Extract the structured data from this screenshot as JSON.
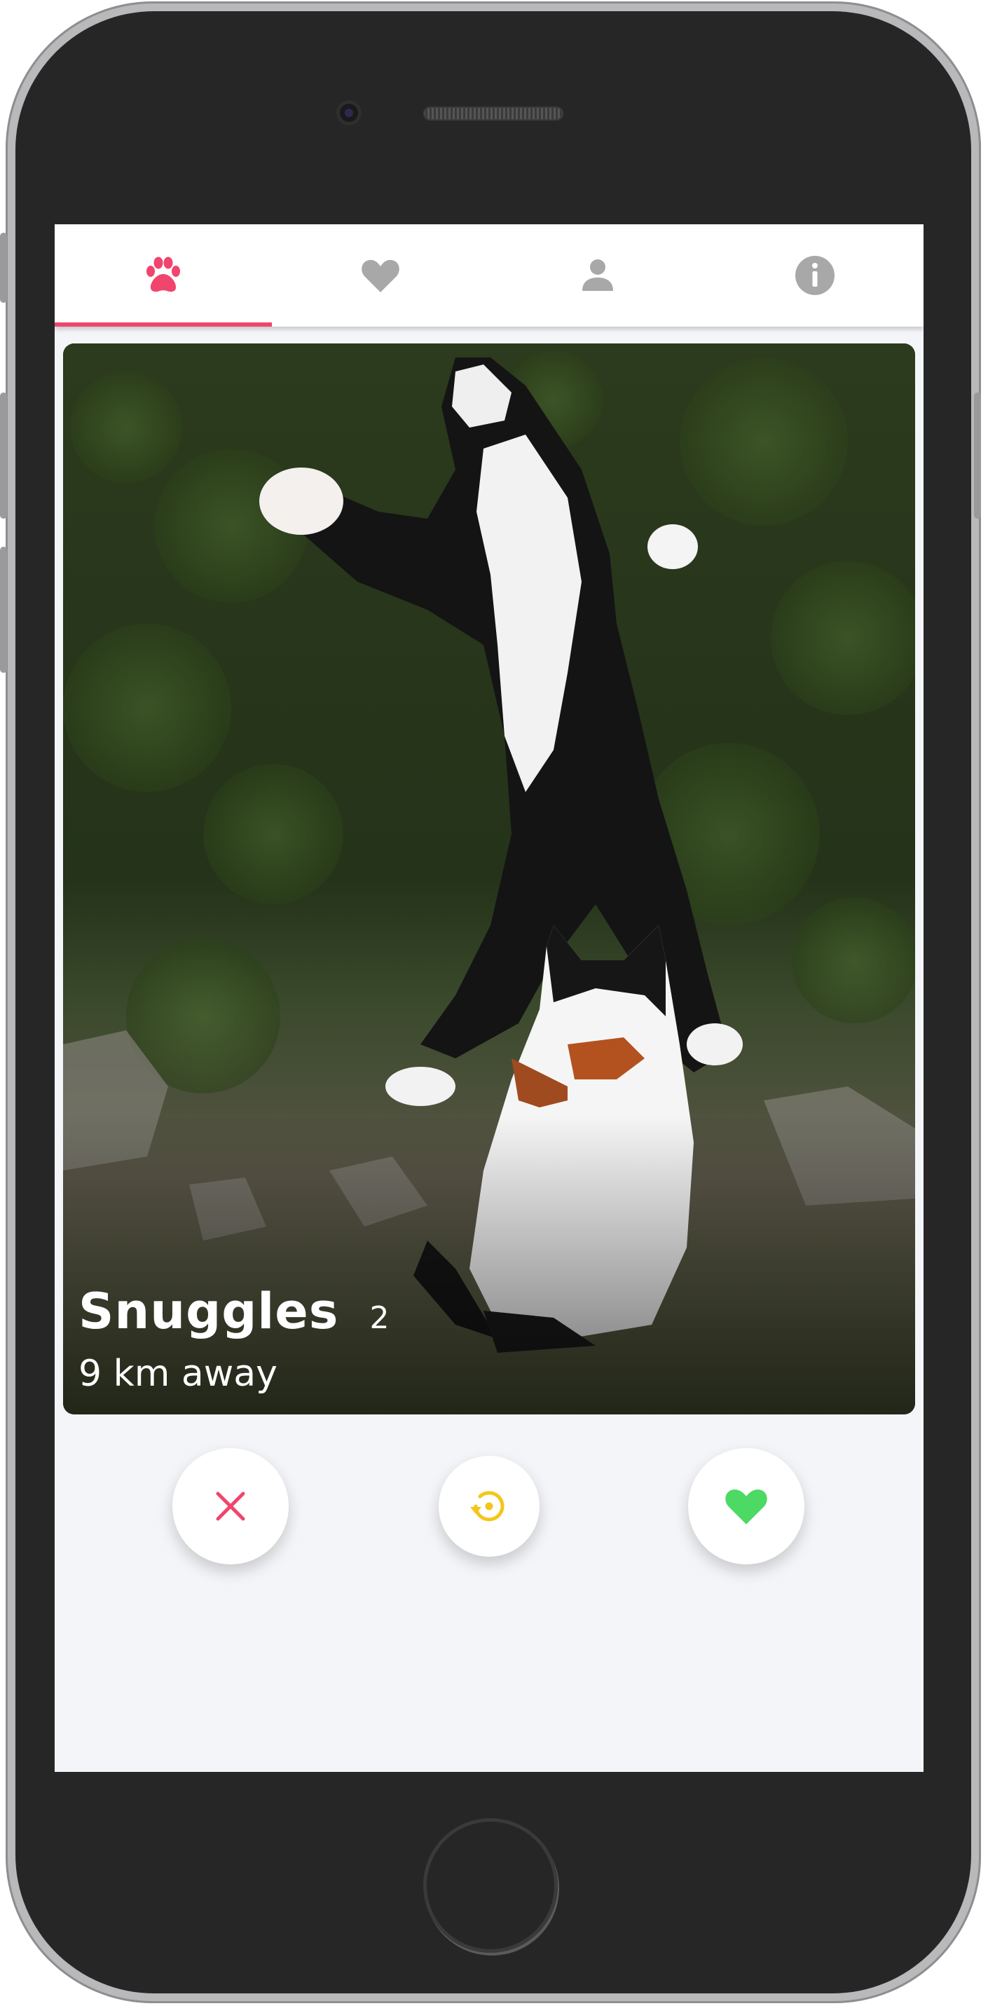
{
  "tabs": [
    {
      "id": "discover",
      "icon": "paw-icon",
      "active": true
    },
    {
      "id": "matches",
      "icon": "heart-icon",
      "active": false
    },
    {
      "id": "profile",
      "icon": "person-icon",
      "active": false
    },
    {
      "id": "info",
      "icon": "info-icon",
      "active": false
    }
  ],
  "profile_card": {
    "name": "Snuggles",
    "age": "2",
    "distance": "9 km away",
    "photo": "two-cats-photo"
  },
  "actions": [
    {
      "id": "dislike",
      "icon": "close-icon"
    },
    {
      "id": "rewind",
      "icon": "rewind-icon"
    },
    {
      "id": "like",
      "icon": "heart-icon"
    }
  ],
  "colors": {
    "accent": "#f0456c",
    "inactive_icon": "#a8a8a8",
    "dislike": "#f0456c",
    "rewind": "#f5c518",
    "like": "#4cd964"
  }
}
